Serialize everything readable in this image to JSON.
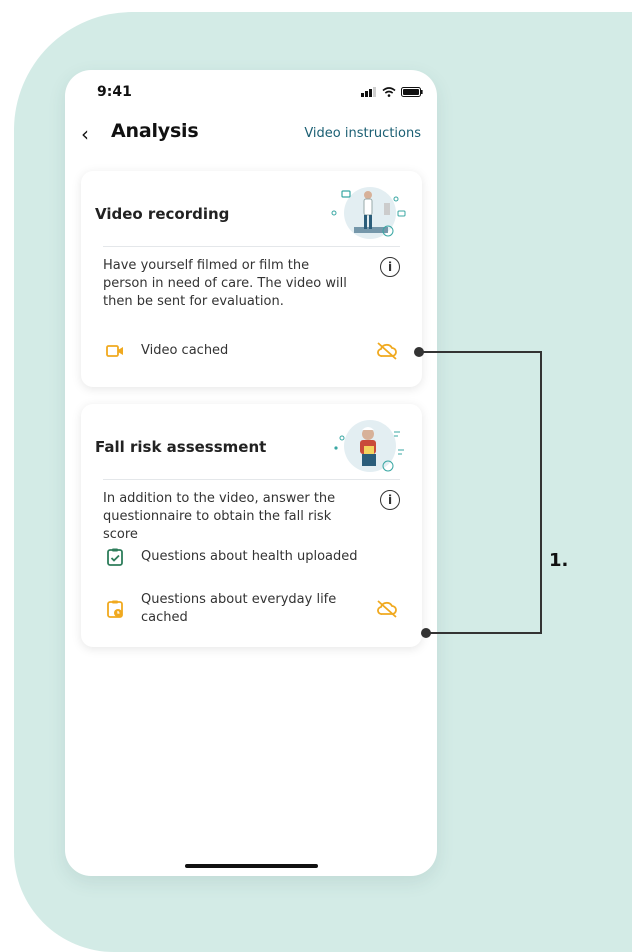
{
  "status": {
    "time": "9:41"
  },
  "header": {
    "title": "Analysis",
    "video_instructions": "Video instructions"
  },
  "card_video": {
    "title": "Video recording",
    "description": "Have yourself filmed or film the person in need of care. The video will then be sent for evaluation.",
    "status_label": "Video cached"
  },
  "card_fall": {
    "title": "Fall risk assessment",
    "description": "In addition to the video, answer the questionnaire to obtain the fall risk score",
    "health_label": "Questions about health uploaded",
    "everyday_label": "Questions about everyday life cached"
  },
  "callout": {
    "label": "1."
  },
  "colors": {
    "background": "#d3ebe6",
    "accent_orange": "#f0a91f",
    "accent_green": "#2e7d5b",
    "link_teal": "#1b5f73"
  }
}
